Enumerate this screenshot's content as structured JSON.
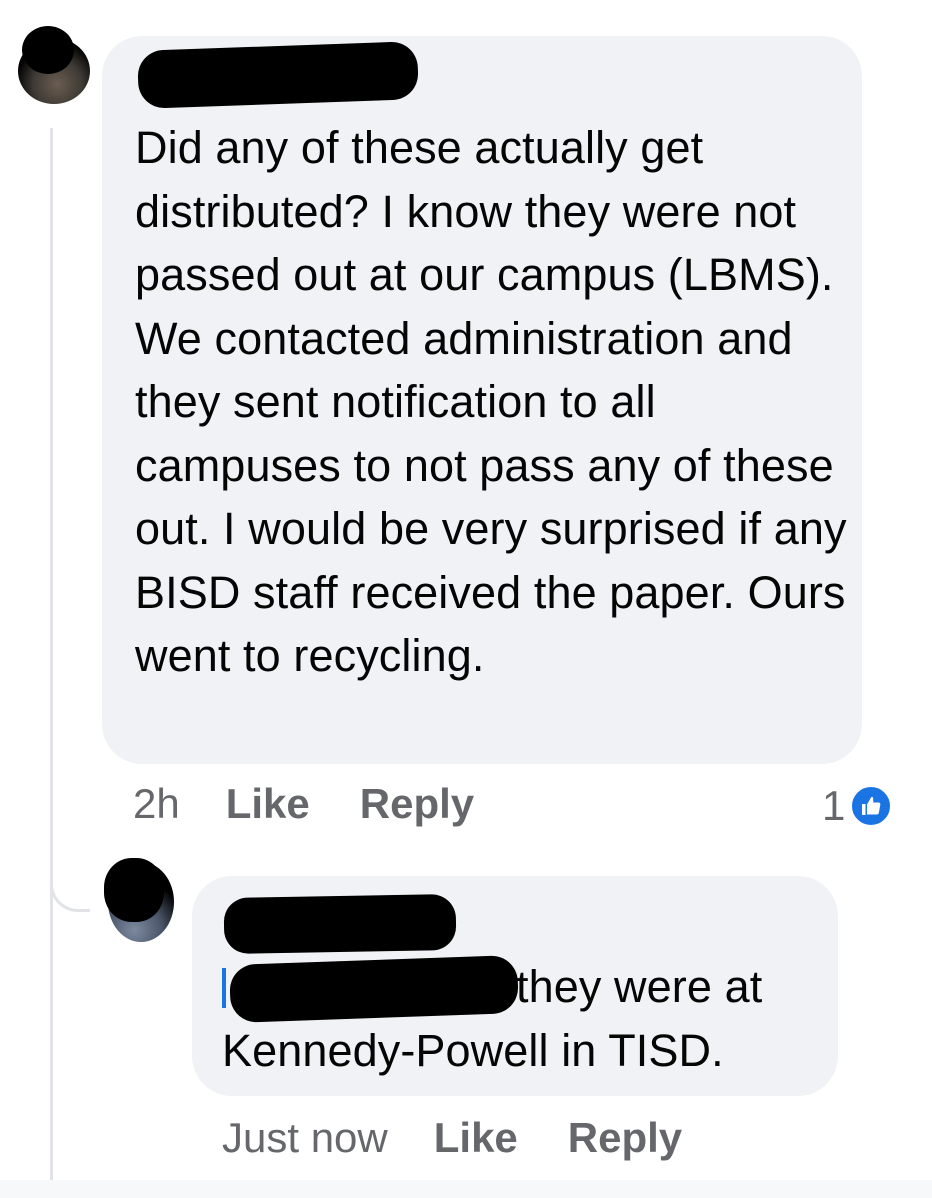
{
  "comments": [
    {
      "author": "",
      "text": "Did any of these actually get distributed? I know they were not passed out at our campus (LBMS). We contacted administration and they sent notification to all campuses to not pass any of these out. I would be very surprised if any BISD staff received the paper. Ours went to recycling.",
      "time": "2h",
      "like_label": "Like",
      "reply_label": "Reply",
      "reaction_count": "1"
    },
    {
      "author": "",
      "mention": "",
      "text": "they were at Kennedy-Powell in TISD.",
      "time": "Just now",
      "like_label": "Like",
      "reply_label": "Reply"
    }
  ],
  "icons": {
    "avatar": "avatar-photo",
    "reaction": "thumbs-up-icon"
  },
  "colors": {
    "bubble": "#f0f2f5",
    "meta_text": "#65676b",
    "like_blue": "#1b74e4",
    "mention_blue": "#1b74e4"
  }
}
